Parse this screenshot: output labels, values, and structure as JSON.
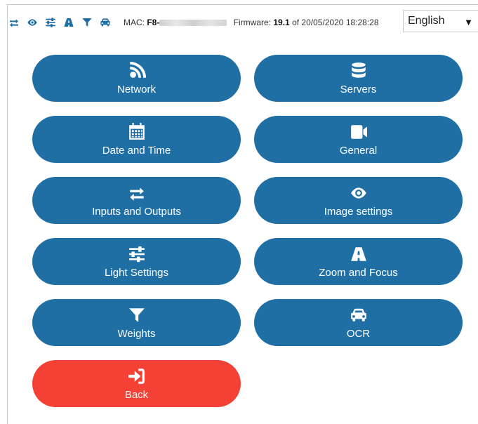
{
  "header": {
    "icons": [
      "transfer-icon",
      "eye-icon",
      "sliders-icon",
      "road-icon",
      "filter-icon",
      "car-icon"
    ],
    "mac_label": "MAC:",
    "mac_value": "F8-",
    "firmware_label": "Firmware:",
    "firmware_version": "19.1",
    "firmware_of": "of 20/05/2020 18:28:28",
    "language": "English"
  },
  "menu": [
    {
      "label": "Network",
      "icon": "rss-icon"
    },
    {
      "label": "Servers",
      "icon": "database-icon"
    },
    {
      "label": "Date and Time",
      "icon": "calendar-icon"
    },
    {
      "label": "General",
      "icon": "video-camera-icon"
    },
    {
      "label": "Inputs and Outputs",
      "icon": "transfer-icon"
    },
    {
      "label": "Image settings",
      "icon": "eye-icon"
    },
    {
      "label": "Light Settings",
      "icon": "sliders-icon"
    },
    {
      "label": "Zoom and Focus",
      "icon": "road-icon"
    },
    {
      "label": "Weights",
      "icon": "filter-icon"
    },
    {
      "label": "OCR",
      "icon": "car-icon"
    }
  ],
  "back": {
    "label": "Back",
    "icon": "sign-in-icon"
  },
  "colors": {
    "primary": "#1f6fa5",
    "danger": "#f34235"
  }
}
